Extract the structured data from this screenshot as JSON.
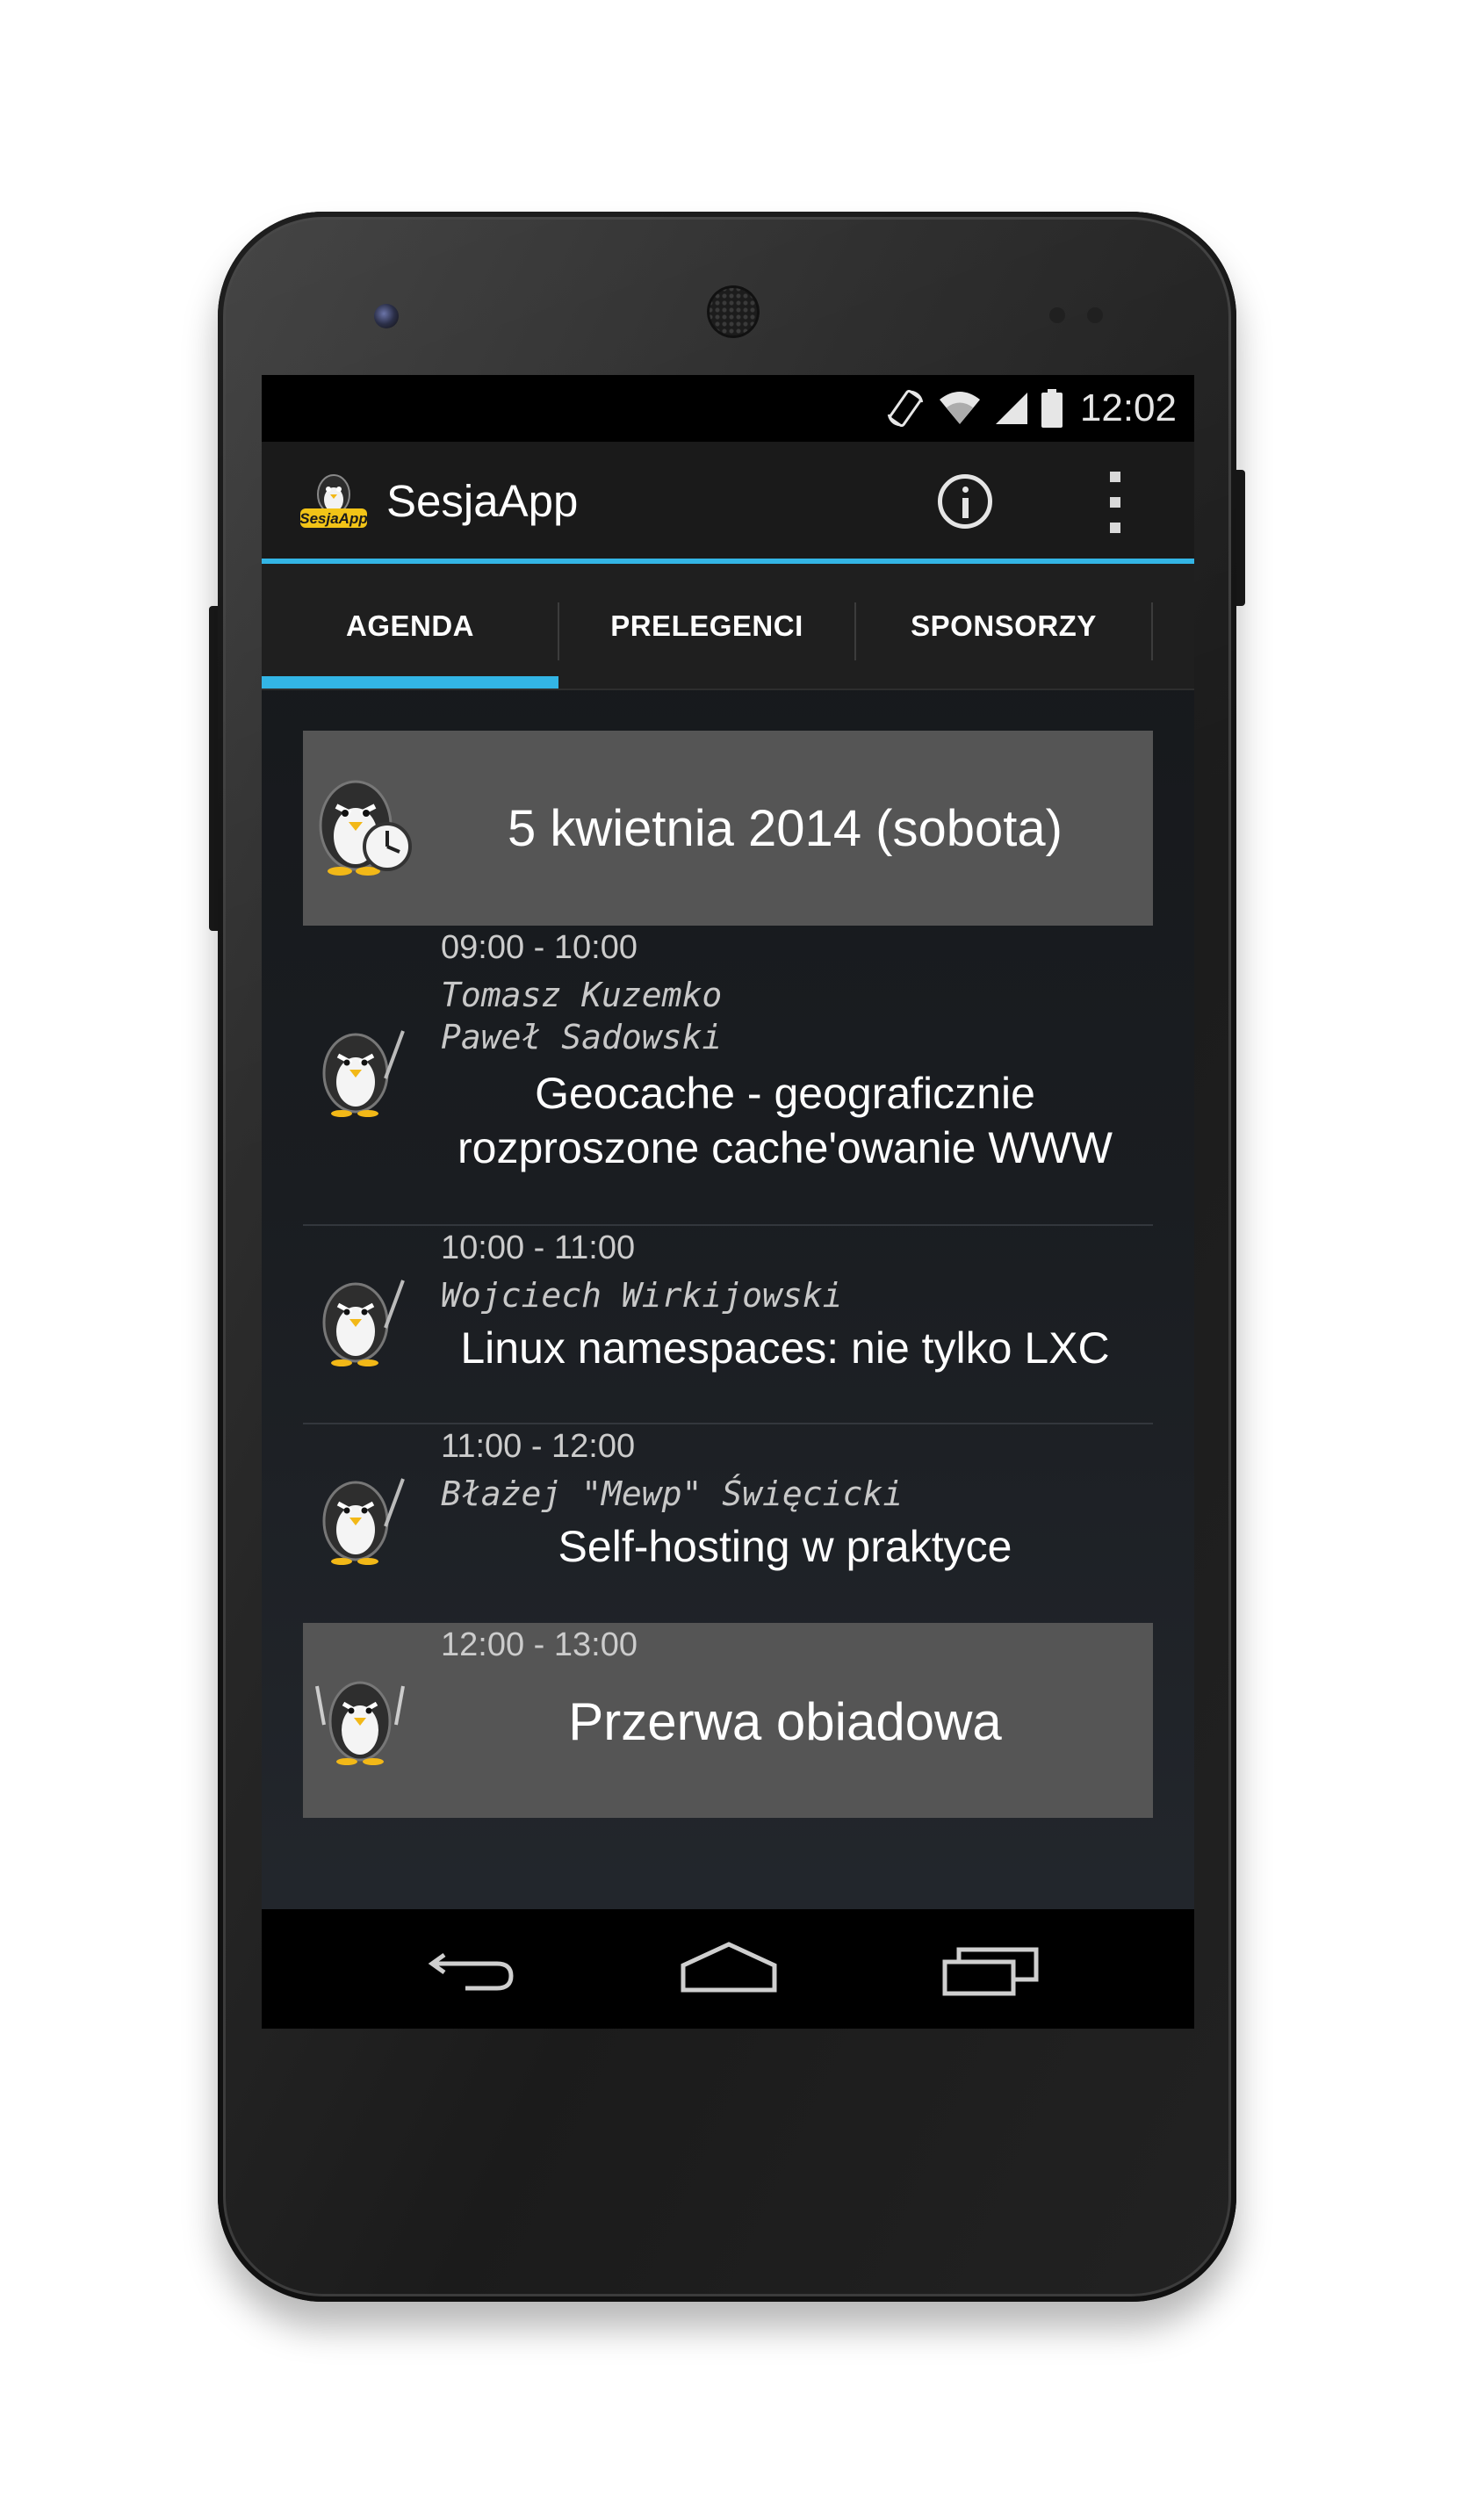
{
  "status_bar": {
    "time": "12:02",
    "icons": [
      "screen-rotation-icon",
      "wifi-icon",
      "signal-icon",
      "battery-icon"
    ]
  },
  "action_bar": {
    "title": "SesjaApp",
    "logo_text": "SesjaApp",
    "actions": [
      "info-icon",
      "overflow-menu-icon"
    ]
  },
  "tabs": [
    {
      "label": "AGENDA",
      "selected": true
    },
    {
      "label": "PRELEGENCI",
      "selected": false
    },
    {
      "label": "SPONSORZY",
      "selected": false
    }
  ],
  "agenda": {
    "day_header": "5 kwietnia 2014 (sobota)",
    "items": [
      {
        "time": "09:00 - 10:00",
        "speakers": "Tomasz Kuzemko\nPaweł Sadowski",
        "title": "Geocache - geograficznie rozproszone cache'owanie WWW",
        "icon": "penguin-speaker-icon"
      },
      {
        "time": "10:00 - 11:00",
        "speakers": "Wojciech Wirkijowski",
        "title": "Linux namespaces: nie tylko LXC",
        "icon": "penguin-speaker-icon"
      },
      {
        "time": "11:00 - 12:00",
        "speakers": "Błażej \"Mewp\" Święcicki",
        "title": "Self-hosting w praktyce",
        "icon": "penguin-speaker-icon"
      },
      {
        "time": "12:00 - 13:00",
        "speakers": "",
        "title": "Przerwa obiadowa",
        "icon": "penguin-lunch-icon"
      }
    ]
  },
  "nav_bar": [
    "back-icon",
    "home-icon",
    "recents-icon"
  ],
  "colors": {
    "accent": "#33b5e5",
    "header_bg": "#555555",
    "bar_bg": "#000000"
  }
}
